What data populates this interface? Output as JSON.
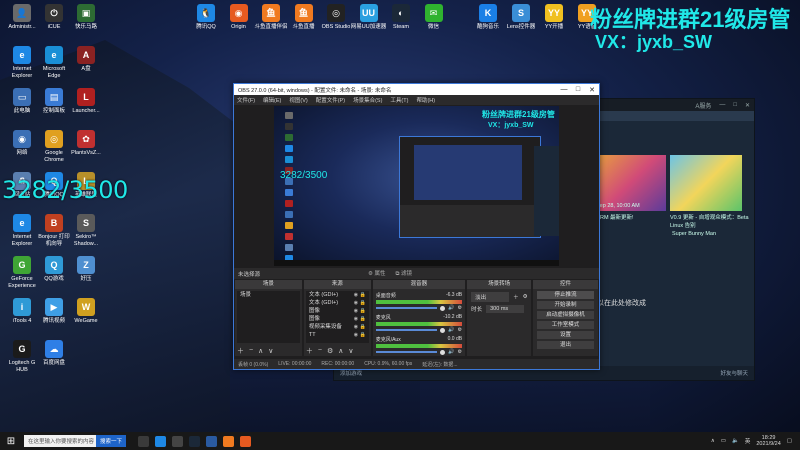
{
  "desktop_left_icons": [
    {
      "label": "Administr...",
      "color": "#6a6a6a",
      "glyph": "👤"
    },
    {
      "label": "iCUE",
      "color": "#333333",
      "glyph": "⏻"
    },
    {
      "label": "快乐马路",
      "color": "#2d6b33",
      "glyph": "▣"
    },
    {
      "label": "Internet Explorer",
      "color": "#1e88e5",
      "glyph": "e"
    },
    {
      "label": "Microsoft Edge",
      "color": "#1a8fd6",
      "glyph": "e"
    },
    {
      "label": "A盘",
      "color": "#8a2222",
      "glyph": "A"
    },
    {
      "label": "此电脑",
      "color": "#3b6fb5",
      "glyph": "▭"
    },
    {
      "label": "控制面板",
      "color": "#3a7bd5",
      "glyph": "▤"
    },
    {
      "label": "Launcher...",
      "color": "#b02020",
      "glyph": "L"
    },
    {
      "label": "网络",
      "color": "#3b6fb5",
      "glyph": "◉"
    },
    {
      "label": "Google Chrome",
      "color": "#e0a020",
      "glyph": "◎"
    },
    {
      "label": "PlantsVsZ...",
      "color": "#c03030",
      "glyph": "✿"
    },
    {
      "label": "回收站",
      "color": "#5a7fb0",
      "glyph": "♻"
    },
    {
      "label": "腾讯QQ",
      "color": "#1e88e5",
      "glyph": "Q"
    },
    {
      "label": "英雄联盟",
      "color": "#b8902a",
      "glyph": "L"
    },
    {
      "label": "Internet Explorer",
      "color": "#1e88e5",
      "glyph": "e"
    },
    {
      "label": "Bonjour 打印机向导",
      "color": "#c04020",
      "glyph": "B"
    },
    {
      "label": "Sekiro™ Shadow...",
      "color": "#5a5a5a",
      "glyph": "S"
    },
    {
      "label": "GeForce Experience",
      "color": "#3fa535",
      "glyph": "G"
    },
    {
      "label": "QQ游戏",
      "color": "#2f9ad6",
      "glyph": "Q"
    },
    {
      "label": "好压",
      "color": "#4f8fd0",
      "glyph": "Z"
    },
    {
      "label": "iTools 4",
      "color": "#2f9ad6",
      "glyph": "i"
    },
    {
      "label": "腾讯视频",
      "color": "#3f9fe6",
      "glyph": "▶"
    },
    {
      "label": "WeGame",
      "color": "#d0a020",
      "glyph": "W"
    },
    {
      "label": "Logitech G HUB",
      "color": "#1b1b1b",
      "glyph": "G"
    },
    {
      "label": "百度网盘",
      "color": "#2f7fe6",
      "glyph": "☁"
    }
  ],
  "desktop_top_icons": [
    {
      "label": "腾讯QQ",
      "color": "#1e88e5",
      "glyph": "🐧"
    },
    {
      "label": "Origin",
      "color": "#e65a20",
      "glyph": "◉"
    },
    {
      "label": "斗鱼直播伴侣",
      "color": "#f07a20",
      "glyph": "鱼"
    },
    {
      "label": "斗鱼直播",
      "color": "#f07a20",
      "glyph": "鱼"
    },
    {
      "label": "OBS Studio",
      "color": "#222222",
      "glyph": "◎"
    },
    {
      "label": "网易UU加速器",
      "color": "#2aa0e0",
      "glyph": "UU"
    },
    {
      "label": "Steam",
      "color": "#1b2838",
      "glyph": "◐"
    },
    {
      "label": "微信",
      "color": "#2fb32f",
      "glyph": "✉"
    }
  ],
  "desktop_right_icons": [
    {
      "label": "酷狗音乐",
      "color": "#1a7fe6",
      "glyph": "K"
    },
    {
      "label": "Lens控件器",
      "color": "#3a8ed6",
      "glyph": "S"
    },
    {
      "label": "YY开播",
      "color": "#f0c020",
      "glyph": "YY"
    },
    {
      "label": "YY语音",
      "color": "#f0a020",
      "glyph": "YY"
    }
  ],
  "overlay_text": {
    "qq_number": "3282/3500",
    "watermark_line1": "粉丝牌进群21级房管",
    "watermark_line2": "VX：jyxb_SW"
  },
  "steam_window": {
    "header_right": [
      "A服务",
      "—",
      "□",
      "✕"
    ],
    "promo1_caption": "DRM 最新更新!",
    "promo2_date": "Sep 28, 10:00 AM",
    "promo3_title": "V0.9 更新 - 自增观众模式：Beta Linux 告别",
    "promo3_sub": "Super Bunny Man",
    "message_line1": "显示的内容。您也可以在此处修改成",
    "message_line2": "删除此列层!",
    "bottom_left": "添加游戏",
    "bottom_right": "好友与聊天"
  },
  "obs": {
    "title": "OBS 27.0.0 (64-bit, windows) - 配置文件: 未命名 - 场景: 未命名",
    "menu": [
      "文件(F)",
      "编辑(E)",
      "视图(V)",
      "配置文件(P)",
      "场景集合(S)",
      "工具(T)",
      "帮助(H)"
    ],
    "status_left": "未选择源",
    "status_properties": "属性",
    "status_filters": "滤镜",
    "docks": {
      "scenes": {
        "title": "场景",
        "items": [
          "场景"
        ]
      },
      "sources": {
        "title": "来源",
        "items": [
          "文本 (GDI+)",
          "文本 (GDI+)",
          "图像",
          "图像",
          "视频采集设备",
          "TT"
        ]
      },
      "mixer": {
        "title": "混音器",
        "channels": [
          {
            "name": "桌面音频",
            "db": "-6.3 dB"
          },
          {
            "name": "麦克风",
            "db": "-10.2 dB"
          },
          {
            "name": "麦克风/Aux",
            "db": "0.0 dB"
          }
        ]
      },
      "transitions": {
        "title": "场景转场",
        "mode": "淡出",
        "duration_label": "时长",
        "duration": "300 ms"
      },
      "controls": {
        "title": "控件",
        "buttons": [
          "停止推流",
          "开始录制",
          "启动虚拟摄像机",
          "工作室模式",
          "设置",
          "退出"
        ]
      }
    },
    "statusbar": [
      "丢帧 0 (0.0%)",
      "LIVE: 00:00:00",
      "REC: 00:00:00",
      "CPU: 0.9%, 60.00 fps",
      "延迟(左): 数据..."
    ]
  },
  "taskbar": {
    "search_placeholder": "在这里输入你要搜索的内容",
    "search_button": "搜索一下",
    "tray_ime": "英",
    "clock_time": "18:29",
    "clock_date": "2021/9/24"
  }
}
